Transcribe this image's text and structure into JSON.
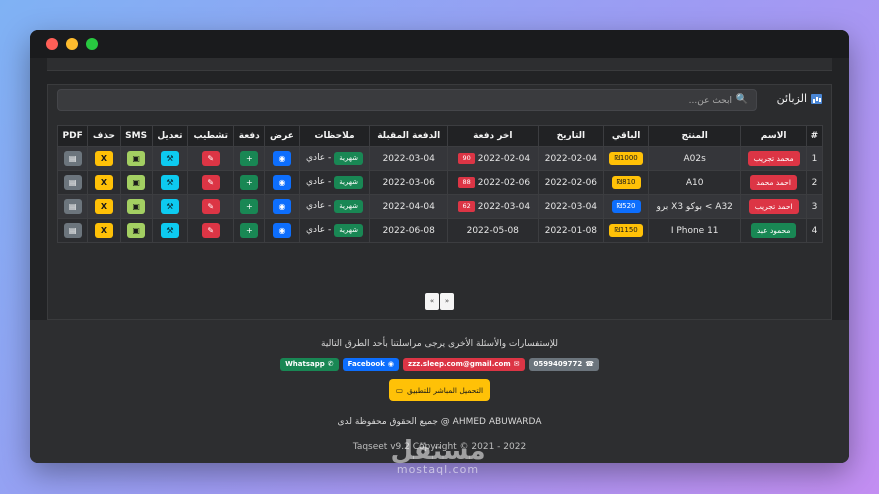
{
  "app": {
    "panel_title": "الزبائن",
    "search": {
      "placeholder": "ابحث عن...",
      "value": ""
    }
  },
  "table": {
    "columns": [
      "#",
      "الاسم",
      "المنتج",
      "الباقي",
      "التاريخ",
      "اخر دفعة",
      "الدفعة المقبلة",
      "ملاحظات",
      "عرض",
      "دفعة",
      "تشطيب",
      "تعديل",
      "SMS",
      "حذف",
      "PDF"
    ],
    "rows": [
      {
        "num": "1",
        "name": "محمد تجريب",
        "name_color": "#dc3545",
        "product": "A02s",
        "remaining": "₪1000",
        "date": "2022-02-04",
        "last_payment": "2022-02-04",
        "last_payment_amount": "90",
        "next_payment": "2022-03-04",
        "note_badge": "شهرية",
        "note_text": "- عادي"
      },
      {
        "num": "2",
        "name": "احمد محمد",
        "name_color": "#dc3545",
        "product": "A10",
        "remaining": "₪810",
        "date": "2022-02-06",
        "last_payment": "2022-02-06",
        "last_payment_amount": "88",
        "next_payment": "2022-03-06",
        "note_badge": "شهرية",
        "note_text": "- عادي"
      },
      {
        "num": "3",
        "name": "احمد تجريب",
        "name_color": "#dc3545",
        "product": "A32 > بوكو X3 برو",
        "remaining": "₪520",
        "remaining_color": "#0d6efd",
        "date": "2022-03-04",
        "last_payment": "2022-03-04",
        "last_payment_amount": "62",
        "next_payment": "2022-04-04",
        "note_badge": "شهرية",
        "note_text": "- عادي"
      },
      {
        "num": "4",
        "name": "محمود عبد",
        "name_color": "#198754",
        "product": "I Phone 11",
        "remaining": "₪1150",
        "date": "2022-01-08",
        "last_payment": "2022-05-08",
        "last_payment_amount": "",
        "next_payment": "2022-06-08",
        "note_badge": "شهرية",
        "note_text": "- عادي"
      }
    ],
    "actions": {
      "view_icon": "eye-icon",
      "pay_icon": "plus-icon",
      "strike_icon": "pencil-icon",
      "edit_icon": "tools-icon",
      "sms_icon": "sms-icon",
      "delete_label": "X",
      "pdf_icon": "document-icon"
    }
  },
  "pagination": {
    "prev": "«",
    "next": "»"
  },
  "footer": {
    "contact_text": "للإستفسارات والأسئلة الأخرى يرجى مراسلتنا بأحد الطرق التالية",
    "phone": "0599409772",
    "email": "zzz.sleep.com@gmail.com",
    "facebook": "Facebook",
    "whatsapp": "Whatsapp",
    "download_label": "التحميل المباشر للتطبيق",
    "rights": "جميع الحقوق محفوظة لدى @ AHMED ABUWARDA",
    "version": "Taqseet v9.2 Copyright © 2021 - 2022"
  },
  "watermark": {
    "arabic": "مستقل",
    "latin": "mostaql.com"
  }
}
